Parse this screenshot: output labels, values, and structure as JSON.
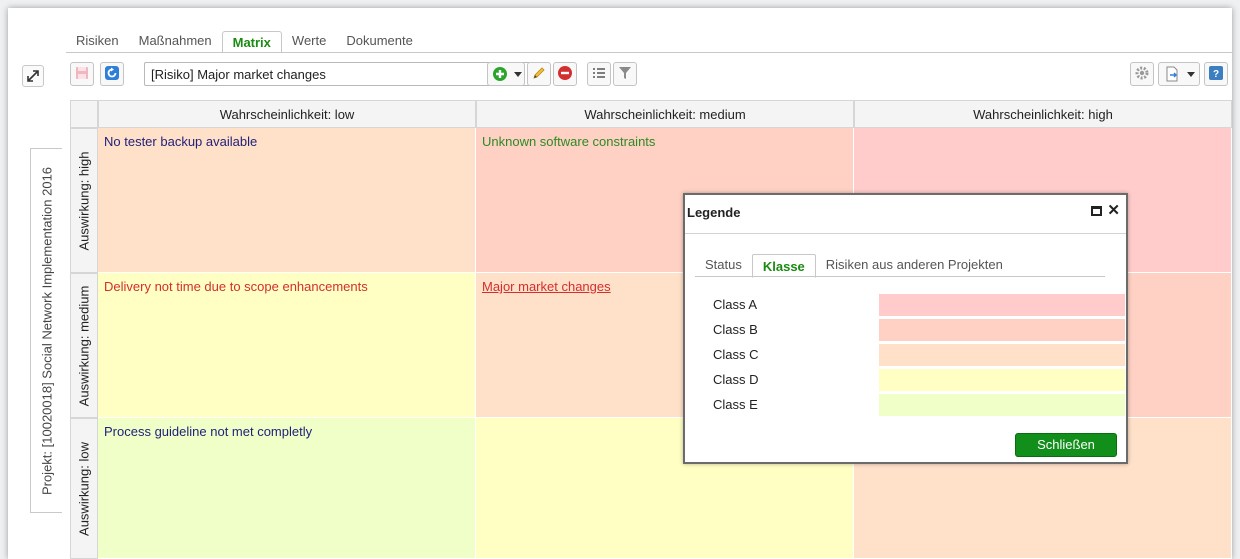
{
  "tabs": [
    {
      "label": "Risiken"
    },
    {
      "label": "Maßnahmen"
    },
    {
      "label": "Matrix",
      "active": true
    },
    {
      "label": "Werte"
    },
    {
      "label": "Dokumente"
    }
  ],
  "project_tab": {
    "label": "Projekt: [10020018] Social Network Implementation 2016"
  },
  "toolbar": {
    "risk_select_value": "[Risiko] Major market changes",
    "icons": [
      "save-icon",
      "refresh-icon",
      "add-icon",
      "dropdown-icon",
      "edit-pencil-icon",
      "delete-icon",
      "list-icon",
      "filter-icon",
      "settings-icon",
      "export-icon",
      "help-icon"
    ]
  },
  "matrix": {
    "columns": [
      "Wahrscheinlichkeit: low",
      "Wahrscheinlichkeit: medium",
      "Wahrscheinlichkeit: high"
    ],
    "rows": [
      "Auswirkung: high",
      "Auswirkung: medium",
      "Auswirkung: low"
    ],
    "cells": {
      "high_low": "No tester backup available",
      "high_medium": "Unknown software constraints",
      "medium_low": "Delivery not time due to scope enhancements",
      "medium_medium": "Major market changes",
      "low_low": "Process guideline not met completly"
    },
    "colors": {
      "class_a": "#ffcccb",
      "class_b": "#ffd1c4",
      "class_c": "#ffe0c8",
      "class_d": "#ffffc4",
      "class_e": "#f0ffc8",
      "text_blue": "#1f1f7a",
      "text_green": "#2d8a23",
      "text_red": "#d32f2f"
    }
  },
  "legend": {
    "title": "Legende",
    "tabs": [
      {
        "label": "Status"
      },
      {
        "label": "Klasse",
        "active": true
      },
      {
        "label": "Risiken aus anderen Projekten"
      }
    ],
    "classes": [
      {
        "label": "Class A",
        "color": "#ffcccb"
      },
      {
        "label": "Class B",
        "color": "#ffd1c4"
      },
      {
        "label": "Class C",
        "color": "#ffe0c8"
      },
      {
        "label": "Class D",
        "color": "#ffffc4"
      },
      {
        "label": "Class E",
        "color": "#f0ffc8"
      }
    ],
    "close_label": "Schließen"
  }
}
